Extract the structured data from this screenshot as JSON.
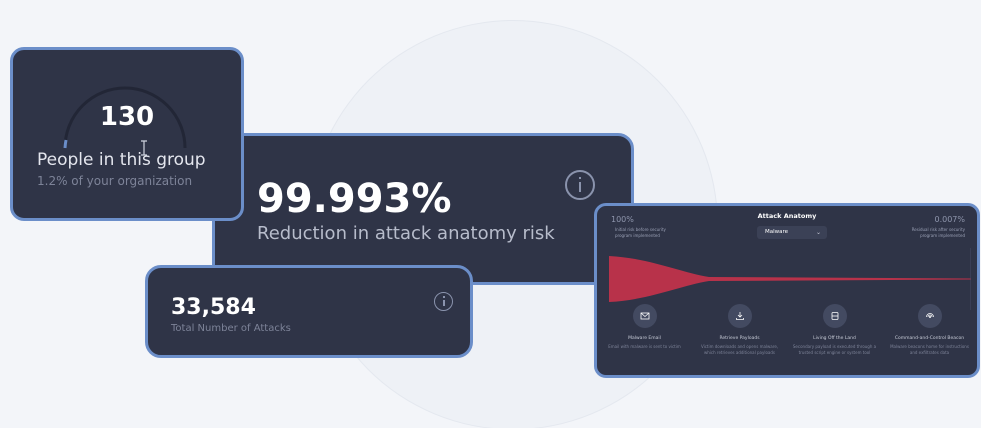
{
  "people_card": {
    "count": "130",
    "label": "People in this group",
    "sublabel": "1.2% of your organization"
  },
  "risk_card": {
    "value": "99.993%",
    "label": "Reduction in attack anatomy risk"
  },
  "attacks_card": {
    "value": "33,584",
    "label": "Total Number of Attacks"
  },
  "anatomy_card": {
    "title": "Attack Anatomy",
    "left_pct": "100%",
    "left_note": "Initial risk before security program implemented",
    "right_pct": "0.007%",
    "right_note": "Residual risk after security program implemented",
    "select_value": "Malware",
    "stages": [
      {
        "icon": "mail-icon",
        "title": "Malware Email",
        "desc": "Email with malware is sent to victim"
      },
      {
        "icon": "download-icon",
        "title": "Retrieve Payloads",
        "desc": "Victim downloads and opens malware, which retrieves additional payloads"
      },
      {
        "icon": "terminal-icon",
        "title": "Living Off the Land",
        "desc": "Secondary payload is executed through a trusted script engine or system tool"
      },
      {
        "icon": "signal-icon",
        "title": "Command-and-Control Beacon",
        "desc": "Malware beacons home for instructions and exfiltrates data"
      }
    ]
  },
  "colors": {
    "card_bg": "#2f3447",
    "card_border": "#6b8ec9",
    "risk_fill": "#b8324a"
  }
}
